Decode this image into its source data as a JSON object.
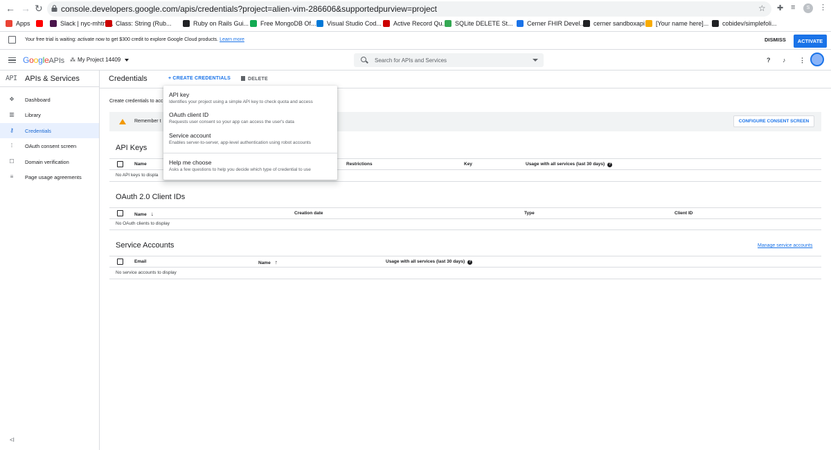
{
  "browser": {
    "url": "console.developers.google.com/apis/credentials?project=alien-vim-286606&supportedpurview=project",
    "profile_initial": "S",
    "bookmarks": [
      {
        "label": "Apps",
        "color": "#ea4335"
      },
      {
        "label": "",
        "color": "#ff0000"
      },
      {
        "label": "Slack | nyc-mhtn-...",
        "color": "#4a154b"
      },
      {
        "label": "Class: String (Rub...",
        "color": "#cc0000"
      },
      {
        "label": "Ruby on Rails Gui...",
        "color": "#202124"
      },
      {
        "label": "Free MongoDB Of...",
        "color": "#13aa52"
      },
      {
        "label": "Visual Studio Cod...",
        "color": "#0078d7"
      },
      {
        "label": "Active Record Qu...",
        "color": "#cc0000"
      },
      {
        "label": "SQLite DELETE St...",
        "color": "#34a853"
      },
      {
        "label": "Cerner FHIR Devel...",
        "color": "#1a73e8"
      },
      {
        "label": "cerner sandboxapi",
        "color": "#202124"
      },
      {
        "label": "[Your name here]...",
        "color": "#f9ab00"
      },
      {
        "label": "cobidev/simplefoli...",
        "color": "#202124"
      }
    ]
  },
  "trial": {
    "text": "Your free trial is waiting: activate now to get $300 credit to explore Google Cloud products.",
    "link": "Learn more",
    "dismiss": "DISMISS",
    "activate": "ACTIVATE"
  },
  "appbar": {
    "logo_google": "Google",
    "logo_apis": "APIs",
    "project": "My Project 14409",
    "search_placeholder": "Search for APIs and Services"
  },
  "sidebar": {
    "icon_text": "API",
    "title": "APIs & Services",
    "items": [
      {
        "label": "Dashboard",
        "icon": "✥",
        "active": false
      },
      {
        "label": "Library",
        "icon": "▥",
        "active": false
      },
      {
        "label": "Credentials",
        "icon": "⚷",
        "active": true
      },
      {
        "label": "OAuth consent screen",
        "icon": "⁞",
        "active": false
      },
      {
        "label": "Domain verification",
        "icon": "☐",
        "active": false
      },
      {
        "label": "Page usage agreements",
        "icon": "≡",
        "active": false
      }
    ],
    "collapse": "<I"
  },
  "main": {
    "title": "Credentials",
    "create_label": "+ CREATE CREDENTIALS",
    "delete_label": "DELETE",
    "intro": "Create credentials to acc",
    "warning": "Remember t",
    "consent_button": "CONFIGURE CONSENT SCREEN",
    "api_keys": {
      "title": "API Keys",
      "columns": [
        "Name",
        "Restrictions",
        "Key",
        "Usage with all services (last 30 days)"
      ],
      "empty": "No API keys to displa"
    },
    "oauth": {
      "title": "OAuth 2.0 Client IDs",
      "columns": [
        "Name",
        "Creation date",
        "Type",
        "Client ID"
      ],
      "empty": "No OAuth clients to display"
    },
    "service_accounts": {
      "title": "Service Accounts",
      "manage_link": "Manage service accounts",
      "columns": [
        "Email",
        "Name",
        "Usage with all services (last 30 days)"
      ],
      "empty": "No service accounts to display"
    }
  },
  "dropdown": {
    "items": [
      {
        "title": "API key",
        "desc": "Identifies your project using a simple API key to check quota and access"
      },
      {
        "title": "OAuth client ID",
        "desc": "Requests user consent so your app can access the user's data"
      },
      {
        "title": "Service account",
        "desc": "Enables server-to-server, app-level authentication using robot accounts"
      },
      {
        "title": "Help me choose",
        "desc": "Asks a few questions to help you decide which type of credential to use"
      }
    ]
  }
}
